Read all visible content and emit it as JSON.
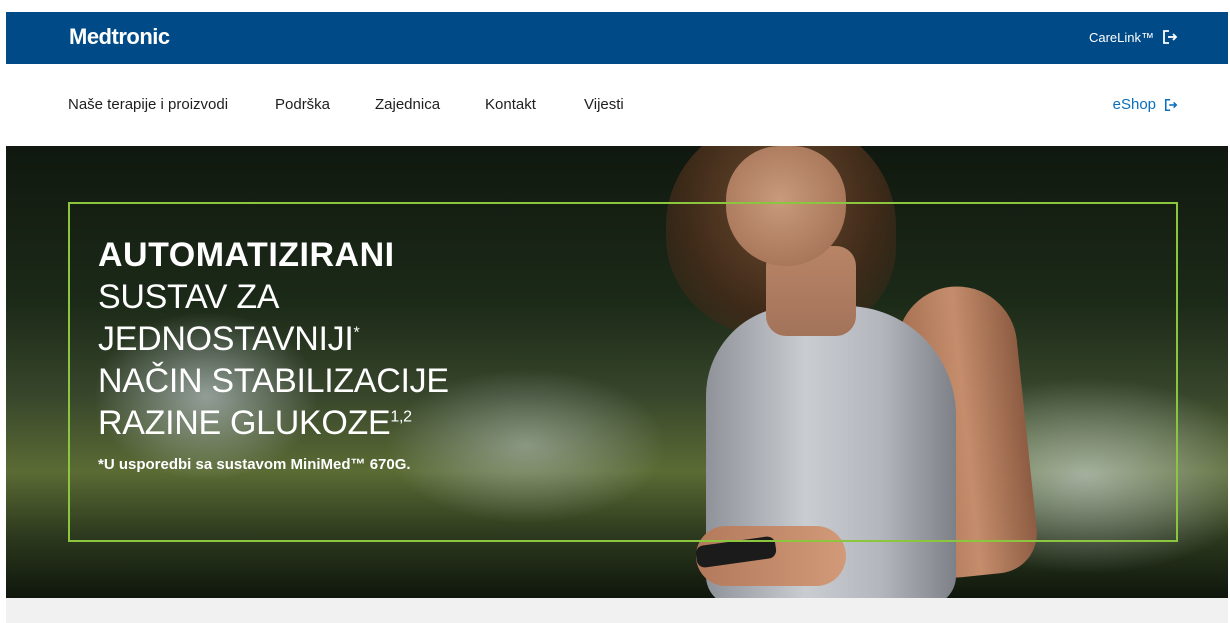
{
  "header": {
    "logo": "Medtronic",
    "carelink_label": "CareLink™"
  },
  "nav": {
    "items": [
      {
        "label": "Naše terapije i proizvodi"
      },
      {
        "label": "Podrška"
      },
      {
        "label": "Zajednica"
      },
      {
        "label": "Kontakt"
      },
      {
        "label": "Vijesti"
      }
    ],
    "eshop_label": "eShop"
  },
  "hero": {
    "line1": "AUTOMATIZIRANI",
    "line2": "SUSTAV ZA",
    "line3": "JEDNOSTAVNIJI",
    "line3_sup": "*",
    "line4": "NAČIN STABILIZACIJE",
    "line5": "RAZINE GLUKOZE",
    "line5_sup": "1,2",
    "note": "*U usporedbi sa sustavom MiniMed™ 670G."
  },
  "colors": {
    "brand_blue": "#004b87",
    "accent_green": "#8cc63f",
    "link_blue": "#0a6ebd"
  }
}
